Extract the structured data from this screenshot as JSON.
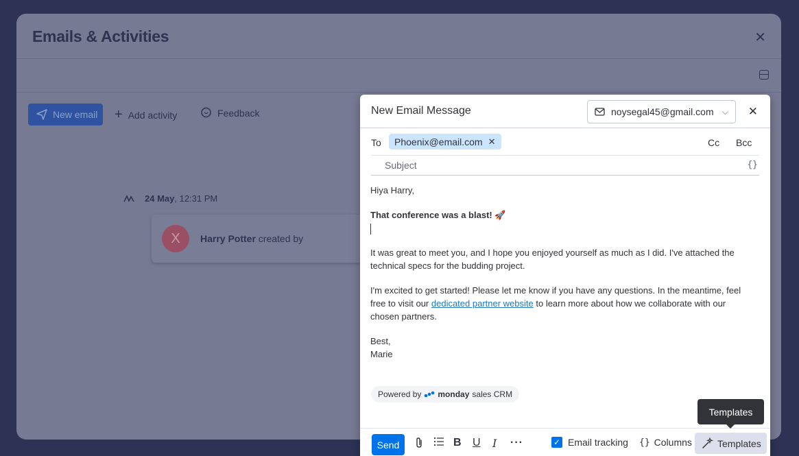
{
  "background": {
    "title": "Emails & Activities",
    "toolbar": {
      "new_email_label": "New email",
      "add_activity_label": "Add activity",
      "feedback_label": "Feedback"
    },
    "timeline": {
      "date": "24 May",
      "time": ", 12:31 PM",
      "avatar_initial": "X",
      "author": "Harry Potter",
      "action": " created by"
    }
  },
  "compose": {
    "title": "New Email Message",
    "from": "noysegal45@gmail.com",
    "to_label": "To",
    "recipient": "Phoenix@email.com",
    "cc_label": "Cc",
    "bcc_label": "Bcc",
    "subject_placeholder": "Subject",
    "vars_icon_text": "{}",
    "body": {
      "greeting": "Hiya Harry,",
      "headline": "That conference was a blast! 🚀",
      "para1": "It was great to meet you, and I hope you enjoyed yourself as much as I did. I've attached the technical specs for the budding project.",
      "para2_before": "I'm excited to get started! Please let me know if you have any questions. In the meantime, feel free to visit our ",
      "para2_link": "dedicated partner website",
      "para2_after": " to learn more about how we collaborate with our chosen partners.",
      "signoff": "Best,",
      "signature": "Marie"
    },
    "powered": {
      "prefix": "Powered by",
      "brand": "monday",
      "suffix": "sales CRM"
    },
    "toolbar": {
      "send_label": "Send",
      "email_tracking_label": "Email tracking",
      "email_tracking_checked": true,
      "columns_label": "Columns",
      "columns_icon_text": "{}",
      "templates_label": "Templates"
    }
  },
  "tooltip": {
    "text": "Templates"
  },
  "colors": {
    "primary": "#0073ea",
    "chip": "#cce5ff",
    "link": "#1f76c2",
    "tooltip": "#323338"
  }
}
